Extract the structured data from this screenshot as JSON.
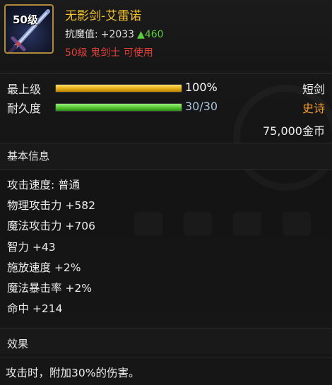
{
  "item": {
    "level_badge": "50级",
    "name": "无影剑-艾雷诺",
    "resist_label": "抗魔值:",
    "resist_base": "+2033",
    "resist_bonus": "▲460",
    "requirement": "50级 鬼剑士 可使用",
    "icon": "sword-icon"
  },
  "bars": {
    "upgrade_label": "最上级",
    "upgrade_value": "100%",
    "upgrade_fraction": 1.0,
    "durability_label": "耐久度",
    "durability_value": "30/30",
    "durability_fraction": 1.0
  },
  "meta": {
    "type": "短剑",
    "grade": "史诗",
    "price": "75,000金币"
  },
  "basic": {
    "title": "基本信息",
    "stats": [
      "攻击速度: 普通",
      "物理攻击力 +582",
      "魔法攻击力 +706",
      "智力 +43",
      "施放速度 +2%",
      "魔法暴击率 +2%",
      "命中 +214"
    ]
  },
  "effect": {
    "title": "效果",
    "text": "攻击时，附加30%的伤害。"
  },
  "colors": {
    "name": "#f2c230",
    "requirement": "#e0403a",
    "bonus": "#5ccc3a",
    "grade": "#f29a2e",
    "durability_value": "#a9c4dc"
  }
}
